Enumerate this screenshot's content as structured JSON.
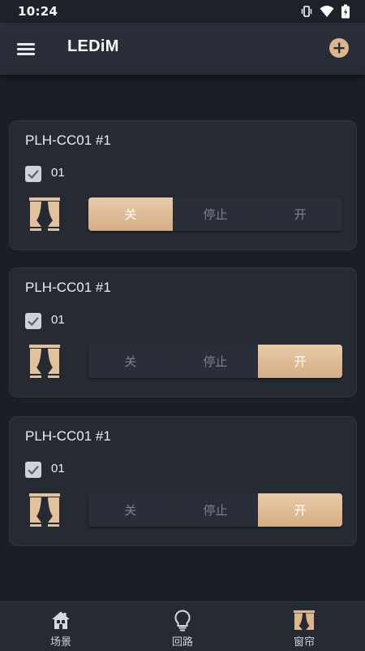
{
  "status_bar": {
    "time": "10:24"
  },
  "app_bar": {
    "title": "LEDiM"
  },
  "cards": [
    {
      "title": "PLH-CC01 #1",
      "checked": true,
      "channel": "01",
      "buttons": [
        "关",
        "停止",
        "开"
      ],
      "active": "关"
    },
    {
      "title": "PLH-CC01 #1",
      "checked": true,
      "channel": "01",
      "buttons": [
        "关",
        "停止",
        "开"
      ],
      "active": "开"
    },
    {
      "title": "PLH-CC01 #1",
      "checked": true,
      "channel": "01",
      "buttons": [
        "关",
        "停止",
        "开"
      ],
      "active": "开"
    }
  ],
  "bottom_nav": [
    {
      "label": "场景",
      "icon": "house-icon"
    },
    {
      "label": "回路",
      "icon": "lightbulb-icon"
    },
    {
      "label": "窗帘",
      "icon": "curtain-icon"
    }
  ],
  "colors": {
    "background": "#1b1e25",
    "card": "#262a33",
    "accent": "#dbb48c",
    "app_bar": "#2a2e38"
  }
}
